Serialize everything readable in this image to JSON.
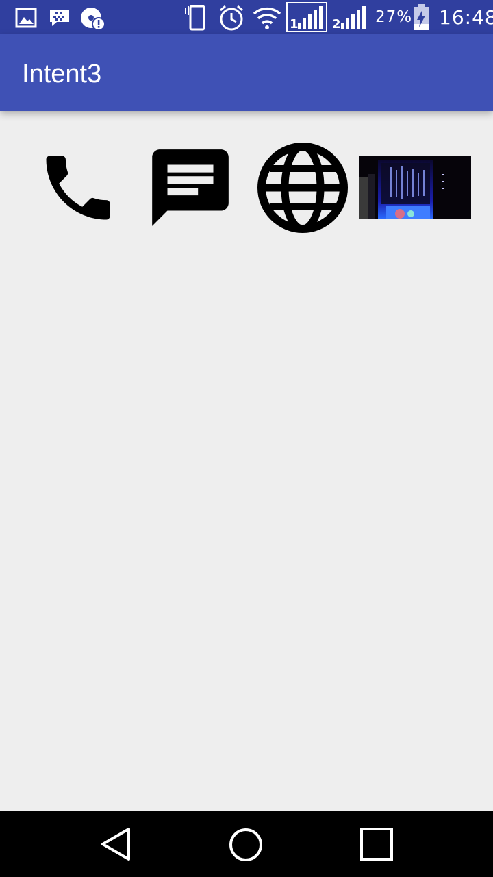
{
  "status_bar": {
    "battery_percent": "27%",
    "time": "16:48",
    "background": "#303f9f",
    "icons": [
      "image-icon",
      "bbm-icon",
      "sync-alert-icon",
      "vibrate-icon",
      "alarm-icon",
      "wifi-icon",
      "signal-sim1-icon",
      "signal-sim2-icon",
      "battery-charging-icon"
    ]
  },
  "app_bar": {
    "title": "Intent3",
    "background": "#3f51b5"
  },
  "content": {
    "background": "#eeeeee",
    "actions": [
      {
        "icon": "phone-icon"
      },
      {
        "icon": "message-icon"
      },
      {
        "icon": "globe-icon"
      },
      {
        "icon": "photo-thumbnail"
      }
    ]
  },
  "nav_bar": {
    "buttons": [
      "back-icon",
      "home-icon",
      "recents-icon"
    ],
    "background": "#000000"
  }
}
